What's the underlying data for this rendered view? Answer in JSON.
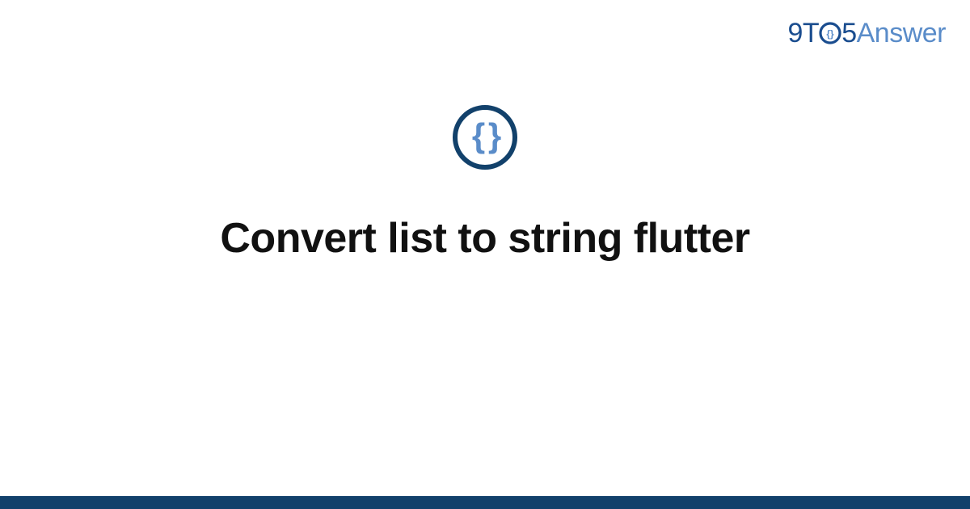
{
  "brand": {
    "part1": "9T",
    "part2": "5",
    "part3": "Answer"
  },
  "topic_icon": {
    "name": "code-braces-icon",
    "glyph": "{ }"
  },
  "title": "Convert list to string flutter",
  "colors": {
    "brand_dark": "#1a4d8f",
    "brand_light": "#5a8cc9",
    "ring": "#12416b",
    "bottom_bar": "#12416b"
  }
}
